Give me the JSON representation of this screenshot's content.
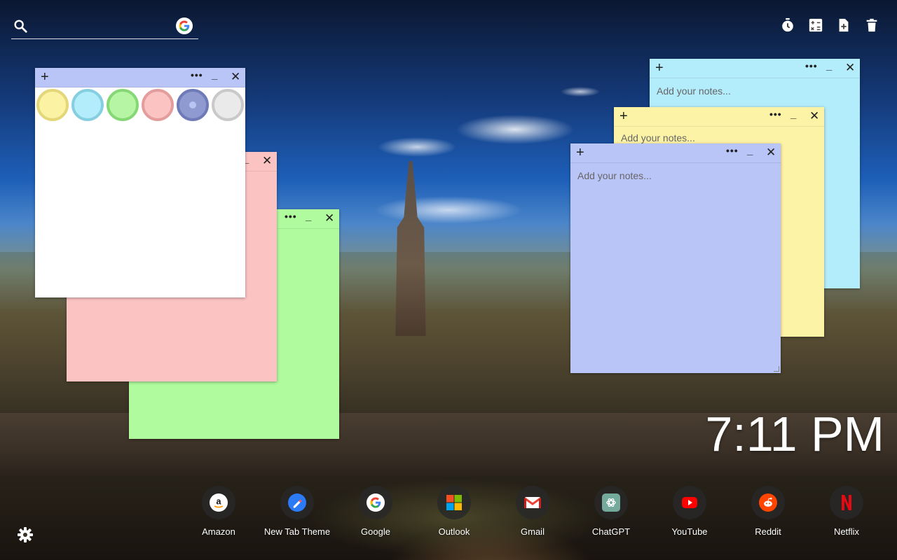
{
  "search": {
    "placeholder": "",
    "engine_icon": "google-icon"
  },
  "toolbar": {
    "icons": [
      "timer-icon",
      "calculator-icon",
      "add-note-icon",
      "trash-icon"
    ]
  },
  "notes": [
    {
      "id": "cyan",
      "color": "#b3ecfa",
      "placeholder": "Add your notes..."
    },
    {
      "id": "yellow",
      "color": "#fdf3a7",
      "placeholder": "Add your notes..."
    },
    {
      "id": "blue",
      "color": "#b9c4f7",
      "placeholder": "Add your notes..."
    },
    {
      "id": "green",
      "color": "#b0fb9e",
      "placeholder": ""
    },
    {
      "id": "pink",
      "color": "#fcc3c3",
      "placeholder": ""
    },
    {
      "id": "white",
      "color": "#ffffff",
      "placeholder": ""
    }
  ],
  "color_picker": {
    "swatches": [
      {
        "fill": "#fbf2a3",
        "ring": "#e3d77a"
      },
      {
        "fill": "#b3ecfa",
        "ring": "#86cfe0"
      },
      {
        "fill": "#b6f5a4",
        "ring": "#86d877"
      },
      {
        "fill": "#fcc3c3",
        "ring": "#e39d9d"
      },
      {
        "fill": "#8e9ad0",
        "ring": "#6e7bb8",
        "selected": true
      },
      {
        "fill": "#eaeaea",
        "ring": "#c9c9c9"
      }
    ]
  },
  "note_controls": {
    "add": "+",
    "menu": "•••",
    "minimize": "_",
    "close": "✕"
  },
  "clock": {
    "time": "7:11 PM"
  },
  "shortcuts": [
    {
      "label": "Amazon",
      "icon": "amazon-icon"
    },
    {
      "label": "New Tab Theme",
      "icon": "new-tab-theme-icon"
    },
    {
      "label": "Google",
      "icon": "google-icon"
    },
    {
      "label": "Outlook",
      "icon": "outlook-icon"
    },
    {
      "label": "Gmail",
      "icon": "gmail-icon"
    },
    {
      "label": "ChatGPT",
      "icon": "chatgpt-icon"
    },
    {
      "label": "YouTube",
      "icon": "youtube-icon"
    },
    {
      "label": "Reddit",
      "icon": "reddit-icon"
    },
    {
      "label": "Netflix",
      "icon": "netflix-icon"
    }
  ],
  "settings": {
    "icon": "gear-icon"
  }
}
